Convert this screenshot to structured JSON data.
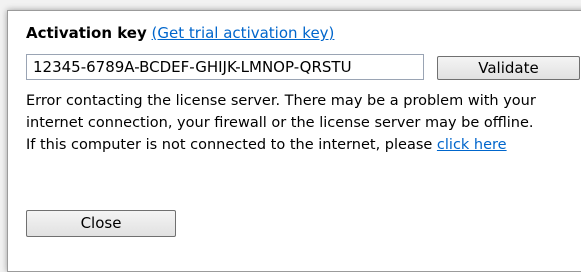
{
  "activation": {
    "label": "Activation key",
    "trial_link": "(Get trial activation key)",
    "key_value": "12345-6789A-BCDEF-GHIJK-LMNOP-QRSTU",
    "validate_label": "Validate"
  },
  "message": {
    "line1": "Error contacting the license server. There may be a problem with your",
    "line2": "internet connection, your firewall or the license server may be offline.",
    "line3_prefix": "If this computer is not connected to the internet, please ",
    "line3_link": "click here"
  },
  "footer": {
    "close_label": "Close"
  }
}
